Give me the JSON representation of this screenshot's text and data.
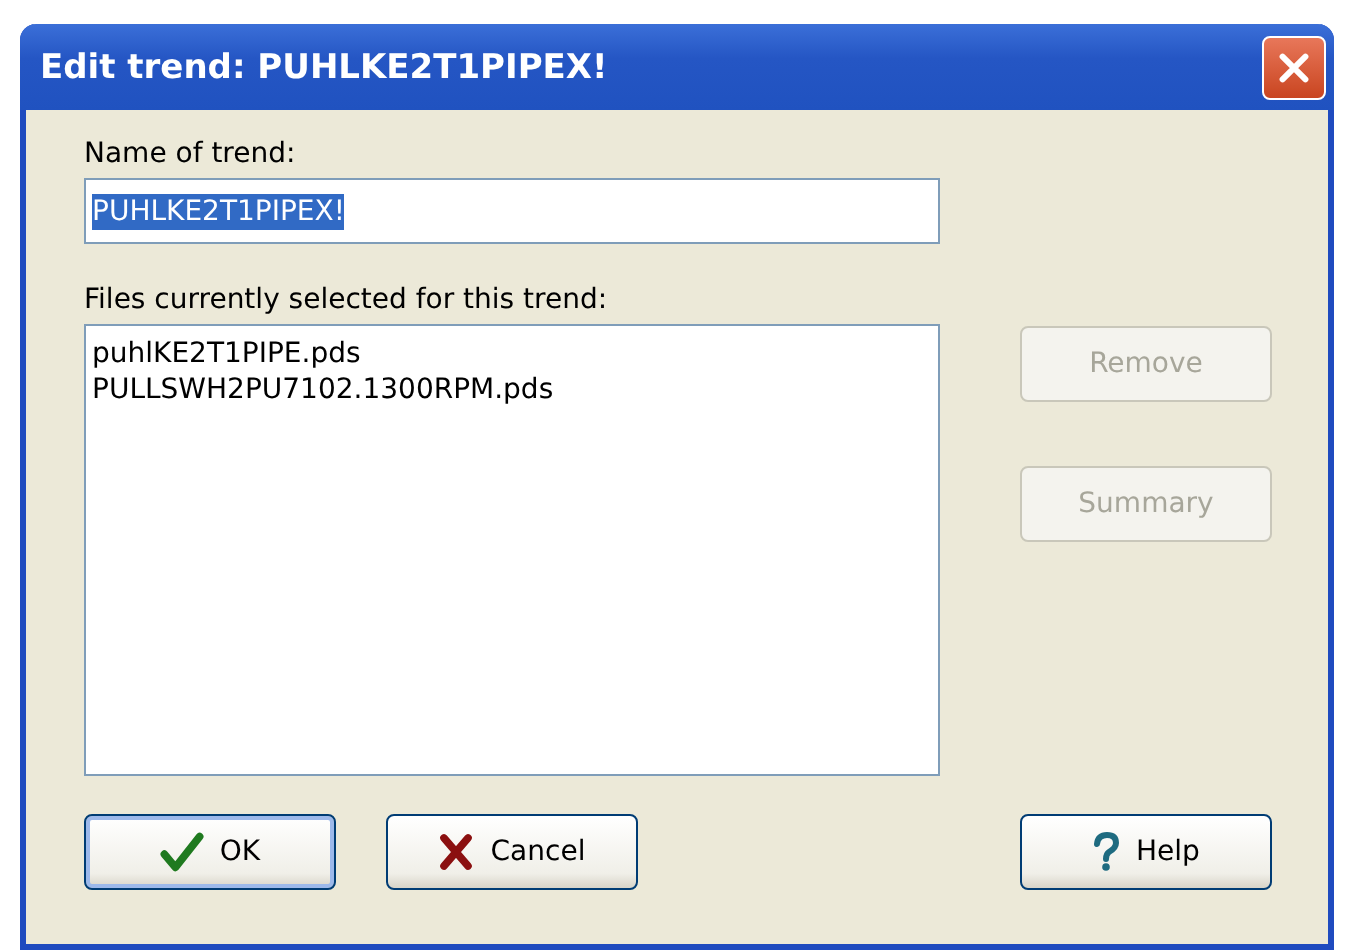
{
  "window": {
    "title": "Edit trend: PUHLKE2T1PIPEX!"
  },
  "name_field": {
    "label": "Name of trend:",
    "value": "PUHLKE2T1PIPEX!",
    "selected": true
  },
  "files": {
    "label": "Files currently selected for this trend:",
    "items": [
      "puhlKE2T1PIPE.pds",
      "PULLSWH2PU7102.1300RPM.pds"
    ]
  },
  "side_buttons": [
    {
      "label": "Remove",
      "disabled": true
    },
    {
      "label": "Summary",
      "disabled": true
    }
  ],
  "bottom_buttons": [
    {
      "label": "OK",
      "kind": "ok",
      "default": true
    },
    {
      "label": "Cancel",
      "kind": "cancel",
      "default": false
    },
    {
      "label": "Help",
      "kind": "help",
      "default": false
    }
  ]
}
